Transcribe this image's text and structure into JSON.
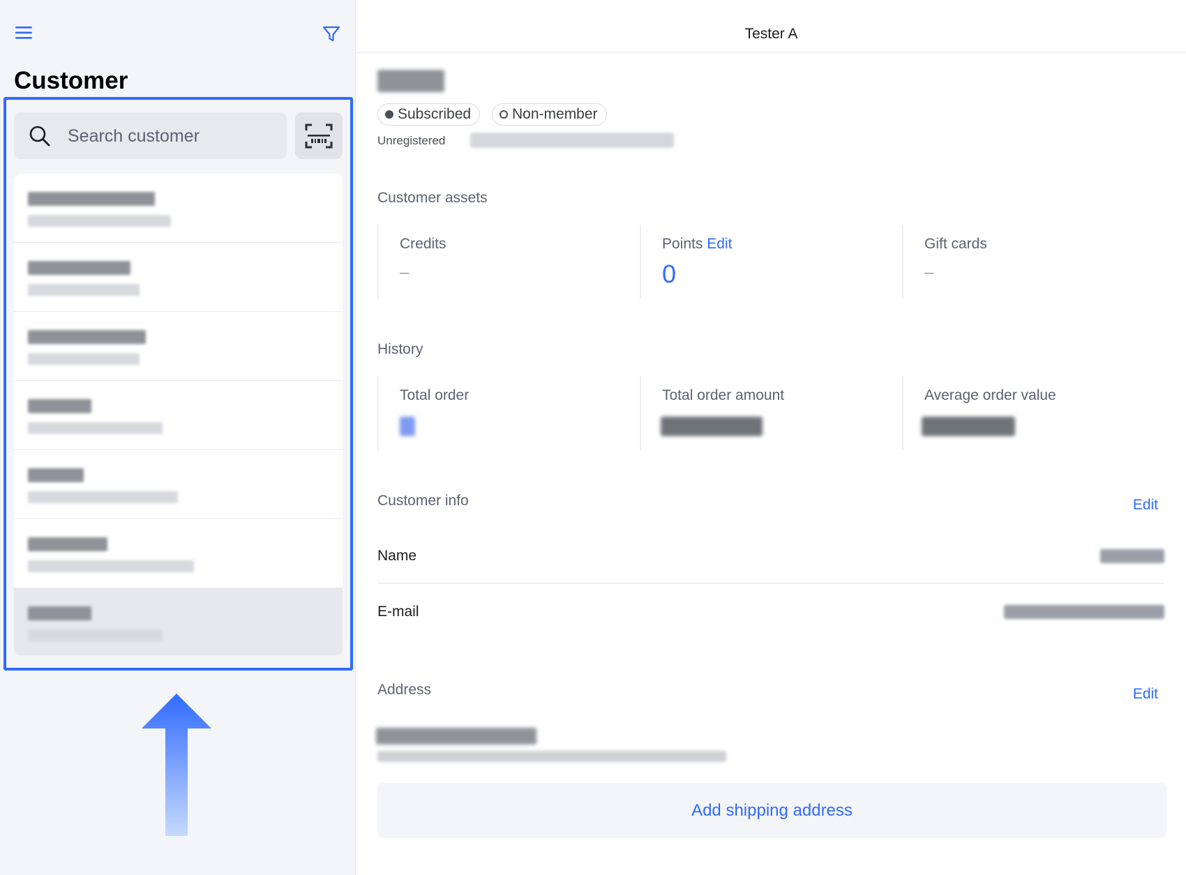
{
  "sidebar": {
    "title": "Customer",
    "search": {
      "placeholder": "Search customer"
    },
    "items": [
      {
        "name": "[redacted]",
        "subtitle": "[redacted]",
        "selected": false
      },
      {
        "name": "[redacted]",
        "subtitle": "[redacted]",
        "selected": false
      },
      {
        "name": "[redacted]",
        "subtitle": "[redacted]",
        "selected": false
      },
      {
        "name": "[redacted]",
        "subtitle": "[redacted]",
        "selected": false
      },
      {
        "name": "[redacted]",
        "subtitle": "[redacted]",
        "selected": false
      },
      {
        "name": "[redacted]",
        "subtitle": "[redacted]",
        "selected": false
      },
      {
        "name": "[redacted]",
        "subtitle": "[redacted]",
        "selected": true
      }
    ]
  },
  "header": {
    "title": "Tester A"
  },
  "profile": {
    "badges": {
      "subscribed": "Subscribed",
      "membership": "Non-member"
    },
    "registration_status": "Unregistered"
  },
  "assets": {
    "heading": "Customer assets",
    "credits": {
      "label": "Credits",
      "value": "–"
    },
    "points": {
      "label": "Points",
      "edit_label": "Edit",
      "value": "0"
    },
    "gift_cards": {
      "label": "Gift cards",
      "value": "–"
    }
  },
  "history": {
    "heading": "History",
    "total_order": {
      "label": "Total order"
    },
    "total_order_amount": {
      "label": "Total order amount"
    },
    "average_order_value": {
      "label": "Average order value"
    }
  },
  "customer_info": {
    "heading": "Customer info",
    "edit_label": "Edit",
    "name_label": "Name",
    "email_label": "E-mail"
  },
  "address": {
    "heading": "Address",
    "edit_label": "Edit",
    "add_shipping_label": "Add shipping address"
  },
  "colors": {
    "accent": "#2f6bff",
    "sidebar_bg": "#f4f5f9",
    "highlight": "#2f6bff"
  },
  "icons": [
    "hamburger-menu-icon",
    "filter-icon",
    "search-icon",
    "barcode-scan-icon",
    "arrow-up-icon"
  ]
}
